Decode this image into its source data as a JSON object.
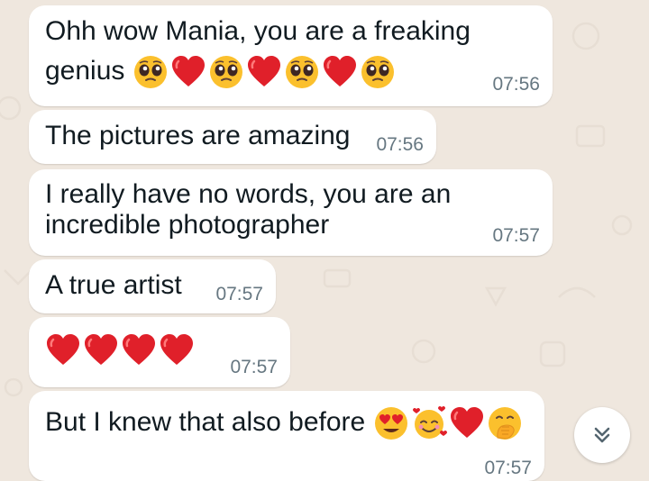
{
  "colors": {
    "chat_background": "#efe7de",
    "bubble": "#ffffff",
    "text": "#111b21",
    "timestamp": "#667781",
    "heart": "#e0202a",
    "emoji_face": "#fbc02d"
  },
  "messages": [
    {
      "line1": "Ohh wow Mania, you are a freaking",
      "line2": "genius",
      "emojis": [
        "pleading-face-icon",
        "red-heart-icon",
        "pleading-face-icon",
        "red-heart-icon",
        "pleading-face-icon",
        "red-heart-icon",
        "pleading-face-icon"
      ],
      "time": "07:56"
    },
    {
      "text": "The pictures are amazing",
      "time": "07:56"
    },
    {
      "line1": "I really have no words, you are an",
      "line2": "incredible photographer",
      "time": "07:57"
    },
    {
      "text": "A true artist",
      "time": "07:57"
    },
    {
      "emojis": [
        "red-heart-icon",
        "red-heart-icon",
        "red-heart-icon",
        "red-heart-icon"
      ],
      "time": "07:57"
    },
    {
      "text": "But I knew that also before",
      "emojis": [
        "heart-eyes-face-icon",
        "smiling-face-with-hearts-icon",
        "red-heart-icon",
        "hand-over-mouth-face-icon"
      ],
      "time": "07:57"
    }
  ],
  "scroll_button": {
    "icon": "double-chevron-down-icon"
  }
}
